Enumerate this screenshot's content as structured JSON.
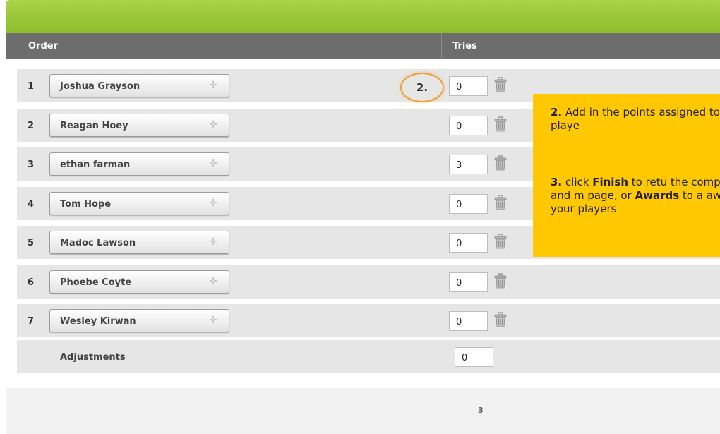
{
  "header": {
    "order_label": "Order",
    "tries_label": "Tries"
  },
  "rows": [
    {
      "num": "1",
      "name": "Joshua Grayson",
      "tries": "0"
    },
    {
      "num": "2",
      "name": "Reagan Hoey",
      "tries": "0"
    },
    {
      "num": "3",
      "name": "ethan farman",
      "tries": "3"
    },
    {
      "num": "4",
      "name": "Tom Hope",
      "tries": "0"
    },
    {
      "num": "5",
      "name": "Madoc Lawson",
      "tries": "0"
    },
    {
      "num": "6",
      "name": "Phoebe Coyte",
      "tries": "0"
    },
    {
      "num": "7",
      "name": "Wesley Kirwan",
      "tries": "0"
    }
  ],
  "adjustments": {
    "label": "Adjustments",
    "value": "0"
  },
  "step_marker": "2.",
  "tooltip": {
    "p1_num": "2.",
    "p1_text": " Add in the points assigned to each playe",
    "p2_num": "3.",
    "p2_a": " click ",
    "p2_finish": "Finish",
    "p2_b": " to retu the competition and m page, or ",
    "p2_awards": "Awards",
    "p2_c": " to a awards to your players"
  },
  "footer": {
    "total": "3"
  },
  "colors": {
    "accent_green": "#9acb3a",
    "header_gray": "#6d6d6d",
    "tooltip_yellow": "#ffc800",
    "marker_orange": "#f0a032"
  }
}
